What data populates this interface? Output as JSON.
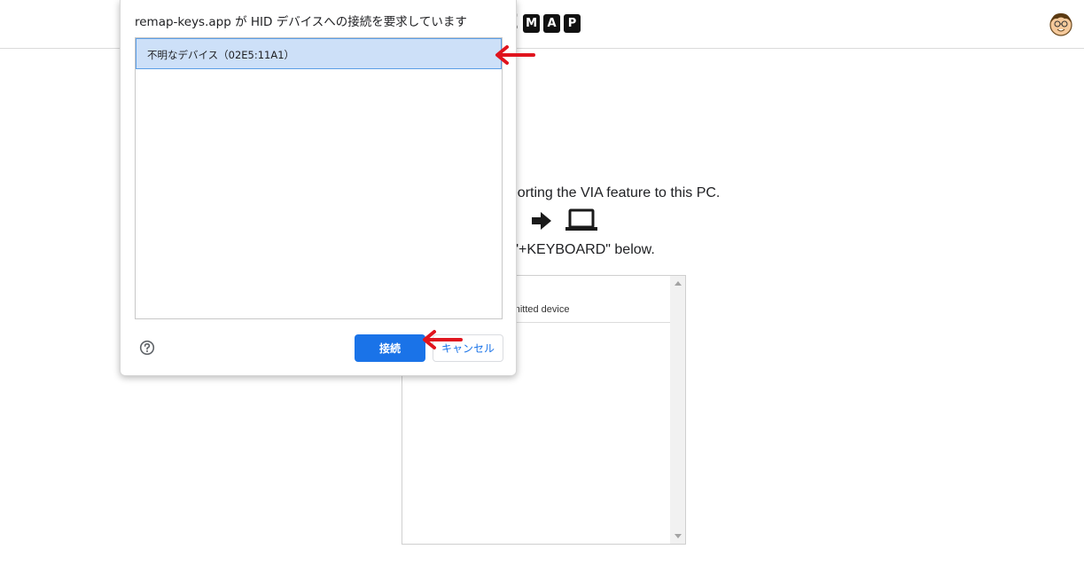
{
  "header": {
    "logo": {
      "lead_fragment": "E",
      "tiles": [
        "M",
        "A",
        "P"
      ]
    }
  },
  "page": {
    "intro_line1": "pporting the VIA feature to this PC.",
    "intro_line2": "e \"+KEYBOARD\" below.",
    "device_list": {
      "caption": "rmitted device"
    }
  },
  "dialog": {
    "title": "remap-keys.app が HID デバイスへの接続を要求しています",
    "devices": [
      {
        "label": "不明なデバイス（02E5:11A1）",
        "selected": true
      }
    ],
    "connect_label": "接続",
    "cancel_label": "キャンセル"
  },
  "colors": {
    "accent": "#1a73e8",
    "selection": "#cde0f8",
    "annotation_arrow": "#e0141e"
  }
}
